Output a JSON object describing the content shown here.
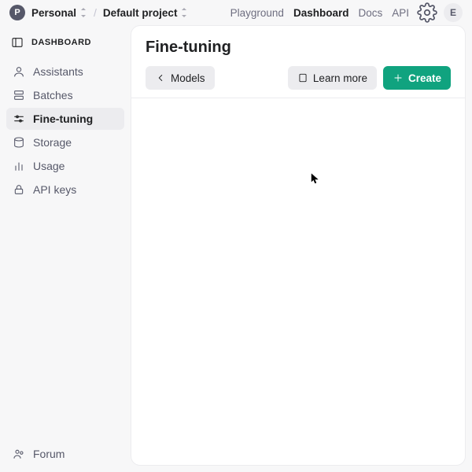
{
  "header": {
    "workspace_initial": "P",
    "workspace_name": "Personal",
    "project_name": "Default project",
    "nav": {
      "playground": "Playground",
      "dashboard": "Dashboard",
      "docs": "Docs",
      "api": "API"
    },
    "user_initial": "E"
  },
  "sidebar": {
    "title": "DASHBOARD",
    "items": [
      {
        "label": "Assistants"
      },
      {
        "label": "Batches"
      },
      {
        "label": "Fine-tuning"
      },
      {
        "label": "Storage"
      },
      {
        "label": "Usage"
      },
      {
        "label": "API keys"
      }
    ],
    "forum": "Forum"
  },
  "main": {
    "title": "Fine-tuning",
    "back_label": "Models",
    "learn_more": "Learn more",
    "create": "Create"
  },
  "colors": {
    "accent": "#10a37f",
    "bg": "#f7f7f8",
    "panel": "#ffffff"
  }
}
